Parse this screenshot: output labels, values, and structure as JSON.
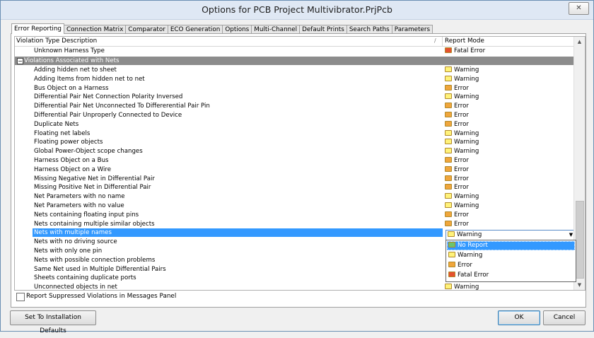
{
  "window": {
    "title": "Options for PCB Project Multivibrator.PrjPcb",
    "close_label": "✕"
  },
  "tabs": [
    {
      "label": "Error Reporting",
      "active": true
    },
    {
      "label": "Connection Matrix"
    },
    {
      "label": "Comparator"
    },
    {
      "label": "ECO Generation"
    },
    {
      "label": "Options"
    },
    {
      "label": "Multi-Channel"
    },
    {
      "label": "Default Prints"
    },
    {
      "label": "Search Paths"
    },
    {
      "label": "Parameters"
    }
  ],
  "grid": {
    "col_description": "Violation Type Description",
    "col_mode": "Report Mode",
    "sort_icon": "/",
    "prev_row": {
      "label": "Unknown Harness Type",
      "mode": "Fatal Error"
    },
    "group": {
      "label": "Violations Associated with Nets",
      "expander": "−"
    },
    "rows": [
      {
        "label": "Adding hidden net to sheet",
        "mode": "Warning"
      },
      {
        "label": "Adding Items from hidden net to net",
        "mode": "Warning"
      },
      {
        "label": "Bus Object on a Harness",
        "mode": "Error"
      },
      {
        "label": "Differential Pair Net Connection Polarity Inversed",
        "mode": "Warning"
      },
      {
        "label": "Differential Pair Net Unconnected To Differerential Pair Pin",
        "mode": "Error"
      },
      {
        "label": "Differential Pair Unproperly Connected to Device",
        "mode": "Error"
      },
      {
        "label": "Duplicate Nets",
        "mode": "Error"
      },
      {
        "label": "Floating net labels",
        "mode": "Warning"
      },
      {
        "label": "Floating power objects",
        "mode": "Warning"
      },
      {
        "label": "Global Power-Object scope changes",
        "mode": "Warning"
      },
      {
        "label": "Harness Object on a Bus",
        "mode": "Error"
      },
      {
        "label": "Harness Object on a Wire",
        "mode": "Error"
      },
      {
        "label": "Missing Negative Net in Differential Pair",
        "mode": "Error"
      },
      {
        "label": "Missing Positive Net in Differential Pair",
        "mode": "Error"
      },
      {
        "label": "Net Parameters with no name",
        "mode": "Warning"
      },
      {
        "label": "Net Parameters with no value",
        "mode": "Warning"
      },
      {
        "label": "Nets containing floating input pins",
        "mode": "Error"
      },
      {
        "label": "Nets containing multiple similar objects",
        "mode": "Error"
      },
      {
        "label": "Nets with multiple names",
        "mode": "Warning",
        "selected": true
      },
      {
        "label": "Nets with no driving source",
        "mode": ""
      },
      {
        "label": "Nets with only one pin",
        "mode": ""
      },
      {
        "label": "Nets with possible connection problems",
        "mode": ""
      },
      {
        "label": "Same Net used in Multiple Differential Pairs",
        "mode": ""
      },
      {
        "label": "Sheets containing duplicate ports",
        "mode": ""
      },
      {
        "label": "Unconnected objects in net",
        "mode": "Warning"
      }
    ],
    "combo_value": "Warning",
    "dropdown_options": [
      {
        "label": "No Report",
        "highlighted": true
      },
      {
        "label": "Warning"
      },
      {
        "label": "Error"
      },
      {
        "label": "Fatal Error"
      }
    ]
  },
  "colors": {
    "warning": "#fff27a",
    "error": "#f0a63c",
    "fatal_error": "#e5512e",
    "no_report": "#6cc46c",
    "selection": "#3399ff",
    "group_bg": "#8c8c8c"
  },
  "footer": {
    "suppress_label": "Report Suppressed Violations in Messages Panel",
    "suppress_checked": false,
    "defaults_button": "Set To Installation Defaults",
    "ok_button": "OK",
    "cancel_button": "Cancel"
  }
}
